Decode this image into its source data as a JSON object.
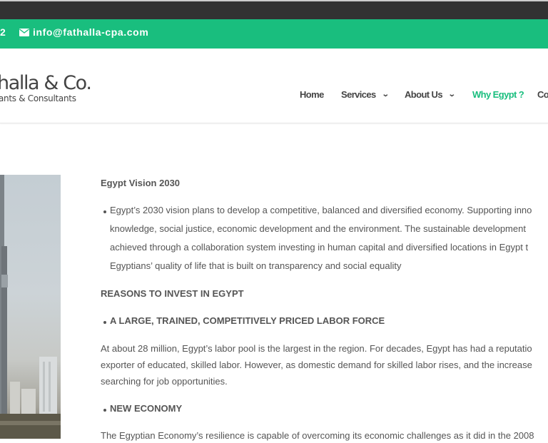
{
  "topbar": {
    "phone_fragment": "2",
    "email": "info@fathalla-cpa.com"
  },
  "logo": {
    "name": "halla & Co.",
    "tagline": "ants & Consultants"
  },
  "nav": {
    "items": [
      {
        "label": "Home"
      },
      {
        "label": "Services"
      },
      {
        "label": "About Us"
      },
      {
        "label": "Why Egypt ?"
      },
      {
        "label": "Co"
      }
    ]
  },
  "article": {
    "title": "Egypt Vision 2030",
    "vision_lines": [
      "Egypt’s 2030 vision plans to develop a competitive, balanced and diversified economy. Supporting inno",
      "knowledge, social justice, economic development and the environment. The sustainable development",
      "achieved through a collaboration system investing in human capital and diversified locations in Egypt t",
      "Egyptians’ quality of life that is built on transparency and social equality"
    ],
    "reasons_heading": "REASONS TO INVEST IN EGYPT",
    "labor_heading": "A LARGE, TRAINED, COMPETITIVELY PRICED LABOR FORCE",
    "labor_lines": [
      "At about 28 million, Egypt’s labor pool is the largest in the region. For decades, Egypt has had a reputatio",
      "exporter of educated, skilled labor. However, as domestic demand for skilled labor rises, and the increase",
      "searching for job opportunities."
    ],
    "economy_heading": "NEW ECONOMY",
    "economy_line": "The Egyptian Economy’s resilience is capable of overcoming its economic challenges as it did in the 2008"
  },
  "colors": {
    "accent": "#19be7e",
    "topbar": "#323232",
    "text": "#555555"
  }
}
